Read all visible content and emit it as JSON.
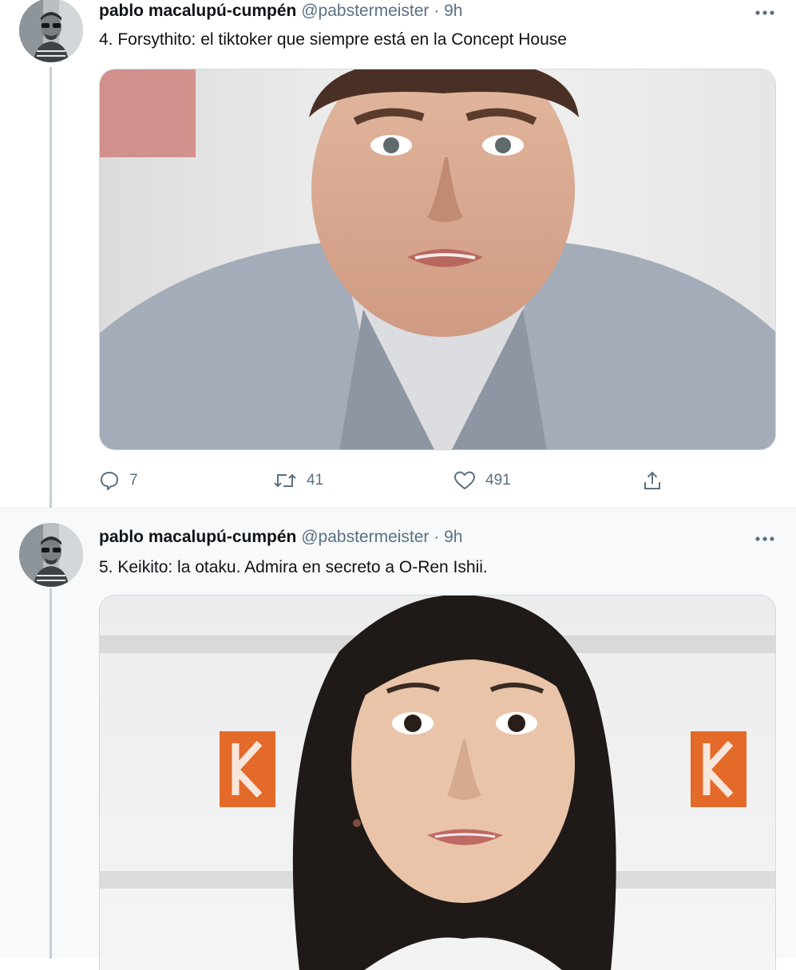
{
  "tweets": [
    {
      "author": {
        "name": "pablo macalupú-cumpén",
        "handle": "@pabstermeister",
        "separator": "·",
        "time": "9h"
      },
      "text": "4. Forsythito: el tiktoker que siempre está en la Concept House",
      "media": {
        "kind": "photo"
      },
      "stats": {
        "replies": "7",
        "retweets": "41",
        "likes": "491"
      },
      "icons": [
        "reply-icon",
        "retweet-icon",
        "like-icon",
        "share-icon",
        "more-icon"
      ]
    },
    {
      "author": {
        "name": "pablo macalupú-cumpén",
        "handle": "@pabstermeister",
        "separator": "·",
        "time": "9h"
      },
      "text": "5. Keikito: la otaku. Admira en secreto a O-Ren Ishii.",
      "media": {
        "kind": "photo"
      }
    }
  ],
  "colors": {
    "text_primary": "#0f1419",
    "text_secondary": "#5b7083",
    "thread_line": "#c4cfd6",
    "highlight_background": "#f7f9fa",
    "border": "#cfd9de"
  }
}
